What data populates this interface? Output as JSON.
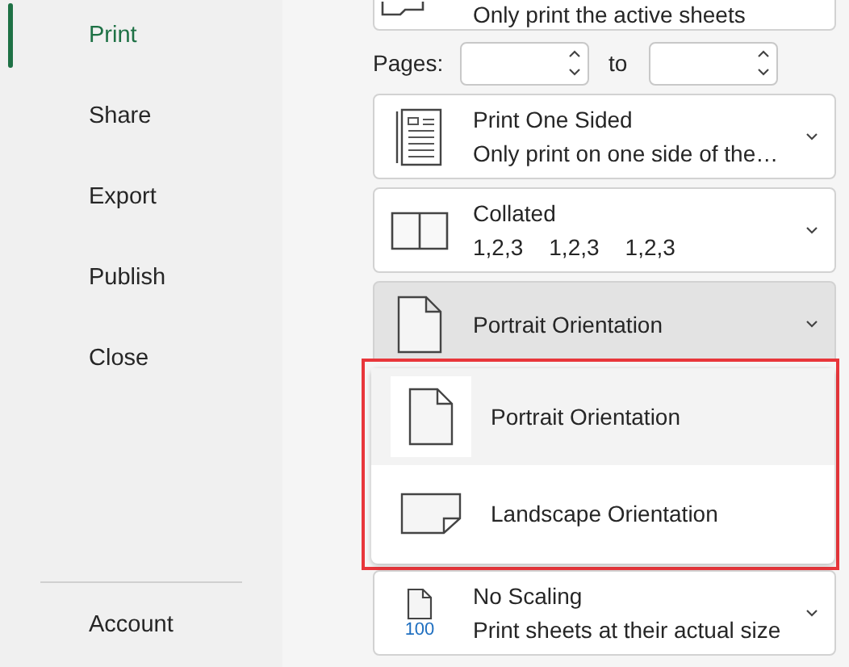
{
  "sidebar": {
    "items": [
      {
        "label": "Print",
        "selected": true
      },
      {
        "label": "Share",
        "selected": false
      },
      {
        "label": "Export",
        "selected": false
      },
      {
        "label": "Publish",
        "selected": false
      },
      {
        "label": "Close",
        "selected": false
      }
    ],
    "footer_items": [
      {
        "label": "Account",
        "selected": false
      }
    ]
  },
  "settings": {
    "top_card": {
      "kind": "sheets",
      "subtitle": "Only print the active sheets"
    },
    "pages": {
      "label": "Pages:",
      "separator": "to"
    },
    "cards": [
      {
        "kind": "sided",
        "title": "Print One Sided",
        "subtitle": "Only print on one side of the…",
        "open": false
      },
      {
        "kind": "collated",
        "title": "Collated",
        "subtitle_parts": [
          "1,2,3",
          "1,2,3",
          "1,2,3"
        ],
        "open": false
      },
      {
        "kind": "portrait",
        "title": "Portrait Orientation",
        "open": true
      }
    ],
    "bottom_card": {
      "kind": "scaling",
      "icon_text": "100",
      "title": "No Scaling",
      "subtitle": "Print sheets at their actual size"
    },
    "dropdown": {
      "items": [
        {
          "kind": "portrait",
          "label": "Portrait Orientation",
          "selected": true
        },
        {
          "kind": "landscape",
          "label": "Landscape Orientation",
          "selected": false
        }
      ]
    }
  }
}
